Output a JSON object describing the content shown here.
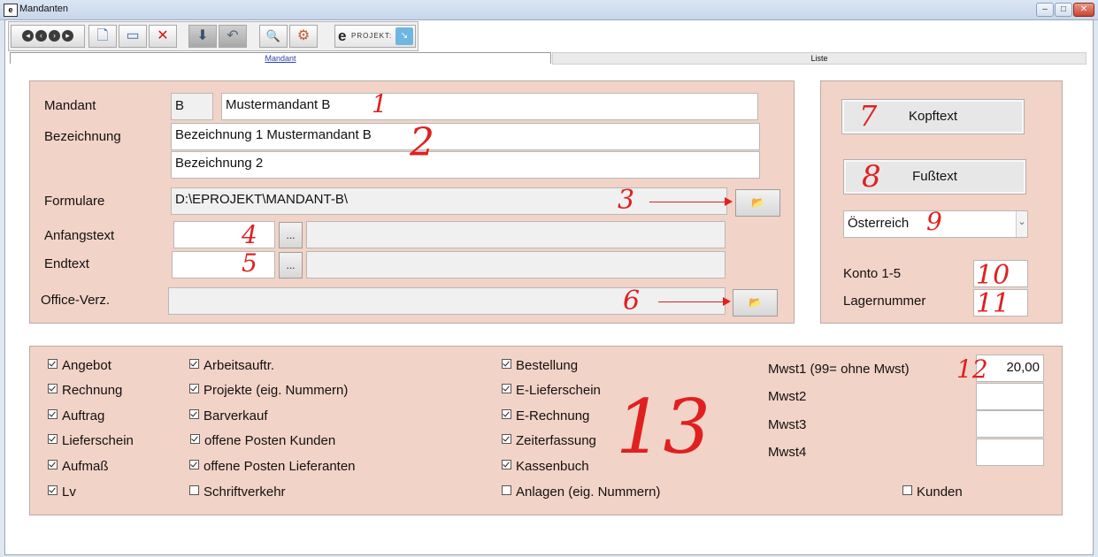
{
  "window": {
    "icon_text": "e",
    "title": "Mandanten",
    "minimize": "–",
    "maximize": "□",
    "close": "✕"
  },
  "toolbar": {
    "nav_icons": [
      "first-record-icon",
      "previous-record-icon",
      "next-record-icon",
      "last-record-icon"
    ],
    "new_icon": "🗋",
    "edit_icon": "▭",
    "delete_icon": "✕",
    "save_icon": "⬇",
    "undo_icon": "↶",
    "search_icon": "🔍",
    "tools_icon": "⚙",
    "logo_e": "e",
    "logo_text": "PROJEKT:",
    "logo_badge": "↘"
  },
  "tabs": {
    "active": "Mandant",
    "inactive": "Liste"
  },
  "mandant": {
    "mandant_label": "Mandant",
    "code": "B",
    "name": "Mustermandant B",
    "bezeichnung_label": "Bezeichnung",
    "bezeichnung1": "Bezeichnung 1 Mustermandant B",
    "bezeichnung2": "Bezeichnung 2",
    "formulare_label": "Formulare",
    "formulare_path": "D:\\EPROJEKT\\MANDANT-B\\",
    "anfangstext_label": "Anfangstext",
    "anfangstext_value": "",
    "anfangstext_desc": "",
    "endtext_label": "Endtext",
    "endtext_value": "",
    "endtext_desc": "",
    "office_label": "Office-Verz.",
    "office_path": "",
    "browse_label": "...",
    "folder_icon": "📂"
  },
  "right": {
    "kopftext": "Kopftext",
    "fusstext": "Fußtext",
    "country": "Österreich",
    "dropdown_icon": "⌄",
    "konto_label": "Konto 1-5",
    "konto_value": "",
    "lager_label": "Lagernummer",
    "lager_value": ""
  },
  "modules": {
    "col1": [
      {
        "label": "Angebot",
        "checked": true
      },
      {
        "label": "Rechnung",
        "checked": true
      },
      {
        "label": "Auftrag",
        "checked": true
      },
      {
        "label": "Lieferschein",
        "checked": true
      },
      {
        "label": "Aufmaß",
        "checked": true
      },
      {
        "label": "Lv",
        "checked": true
      }
    ],
    "col2": [
      {
        "label": "Arbeitsauftr.",
        "checked": true
      },
      {
        "label": "Projekte (eig. Nummern)",
        "checked": true
      },
      {
        "label": "Barverkauf",
        "checked": true
      },
      {
        "label": "offene Posten Kunden",
        "checked": true
      },
      {
        "label": "offene Posten Lieferanten",
        "checked": true
      },
      {
        "label": "Schriftverkehr",
        "checked": false
      }
    ],
    "col3": [
      {
        "label": "Bestellung",
        "checked": true
      },
      {
        "label": "E-Lieferschein",
        "checked": true
      },
      {
        "label": "E-Rechnung",
        "checked": true
      },
      {
        "label": "Zeiterfassung",
        "checked": true
      },
      {
        "label": "Kassenbuch",
        "checked": true
      },
      {
        "label": "Anlagen (eig. Nummern)",
        "checked": false
      }
    ],
    "kunden": {
      "label": "Kunden",
      "checked": false
    }
  },
  "mwst": {
    "mwst1_label": "Mwst1 (99= ohne Mwst)",
    "mwst1_value": "20,00",
    "mwst2_label": "Mwst2",
    "mwst2_value": "",
    "mwst3_label": "Mwst3",
    "mwst3_value": "",
    "mwst4_label": "Mwst4",
    "mwst4_value": ""
  },
  "annotations": [
    "1",
    "2",
    "3",
    "4",
    "5",
    "6",
    "7",
    "8",
    "9",
    "10",
    "11",
    "12",
    "13"
  ]
}
